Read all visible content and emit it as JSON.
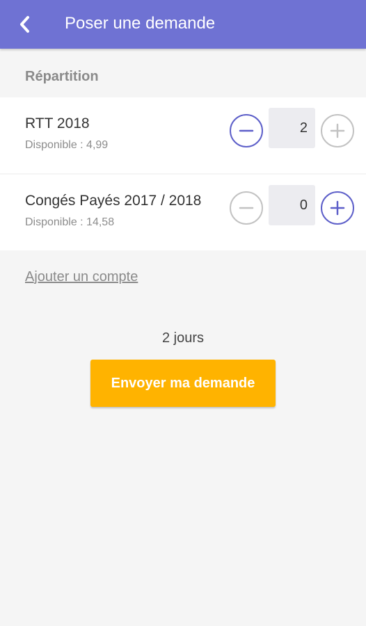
{
  "header": {
    "title": "Poser une demande",
    "back_icon": "chevron-left-icon",
    "background_color": "#6f72d3"
  },
  "section": {
    "label": "Répartition"
  },
  "accounts": [
    {
      "name": "RTT 2018",
      "available_label": "Disponible : ",
      "available_value": "4,99",
      "quantity": "2",
      "minus_enabled": true,
      "plus_enabled": false
    },
    {
      "name": "Congés Payés 2017 / 2018",
      "available_label": "Disponible : ",
      "available_value": "14,58",
      "quantity": "0",
      "minus_enabled": false,
      "plus_enabled": true
    }
  ],
  "add_account_link": "Ajouter un compte",
  "total": "2 jours",
  "submit_button": {
    "label": "Envoyer ma demande",
    "color": "#ffb300"
  },
  "colors": {
    "accent": "#5d5fc9",
    "disabled": "#c2c2c2"
  }
}
